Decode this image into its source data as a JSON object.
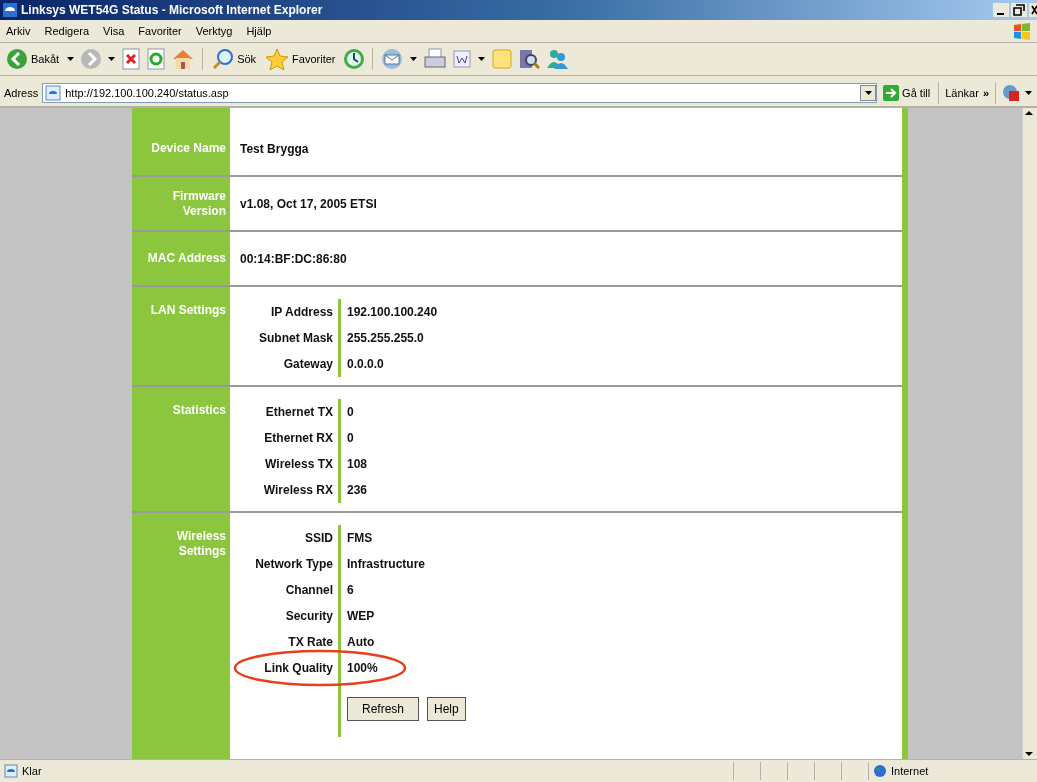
{
  "window": {
    "title": "Linksys WET54G Status - Microsoft Internet Explorer"
  },
  "menu": [
    "Arkiv",
    "Redigera",
    "Visa",
    "Favoriter",
    "Verktyg",
    "Hjälp"
  ],
  "toolbar": {
    "back": "Bakåt",
    "search": "Sök",
    "favorites": "Favoriter"
  },
  "address_bar": {
    "label": "Adress",
    "value": "http://192.100.100.240/status.asp",
    "go": "Gå till",
    "links": "Länkar",
    "more": "»"
  },
  "sections": [
    {
      "label": "Device Name",
      "value": "Test Brygga"
    },
    {
      "label": "Firmware Version",
      "value": "v1.08, Oct 17, 2005 ETSI"
    },
    {
      "label": "MAC Address",
      "value": "00:14:BF:DC:86:80"
    },
    {
      "label": "LAN Settings",
      "fields": [
        {
          "label": "IP Address",
          "value": "192.100.100.240",
          "circled": false
        },
        {
          "label": "Subnet Mask",
          "value": "255.255.255.0",
          "circled": false
        },
        {
          "label": "Gateway",
          "value": "0.0.0.0",
          "circled": false
        }
      ]
    },
    {
      "label": "Statistics",
      "fields": [
        {
          "label": "Ethernet TX",
          "value": "0",
          "circled": false
        },
        {
          "label": "Ethernet RX",
          "value": "0",
          "circled": false
        },
        {
          "label": "Wireless TX",
          "value": "108",
          "circled": false
        },
        {
          "label": "Wireless RX",
          "value": "236",
          "circled": false
        }
      ]
    },
    {
      "label": "Wireless Settings",
      "fields": [
        {
          "label": "SSID",
          "value": "FMS",
          "circled": false
        },
        {
          "label": "Network Type",
          "value": "Infrastructure",
          "circled": false
        },
        {
          "label": "Channel",
          "value": "6",
          "circled": false
        },
        {
          "label": "Security",
          "value": "WEP",
          "circled": false
        },
        {
          "label": "TX Rate",
          "value": "Auto",
          "circled": false
        },
        {
          "label": "Link Quality",
          "value": "100%",
          "circled": true
        }
      ],
      "buttons": [
        "Refresh",
        "Help"
      ]
    }
  ],
  "status_bar": {
    "text": "Klar",
    "zone": "Internet"
  }
}
